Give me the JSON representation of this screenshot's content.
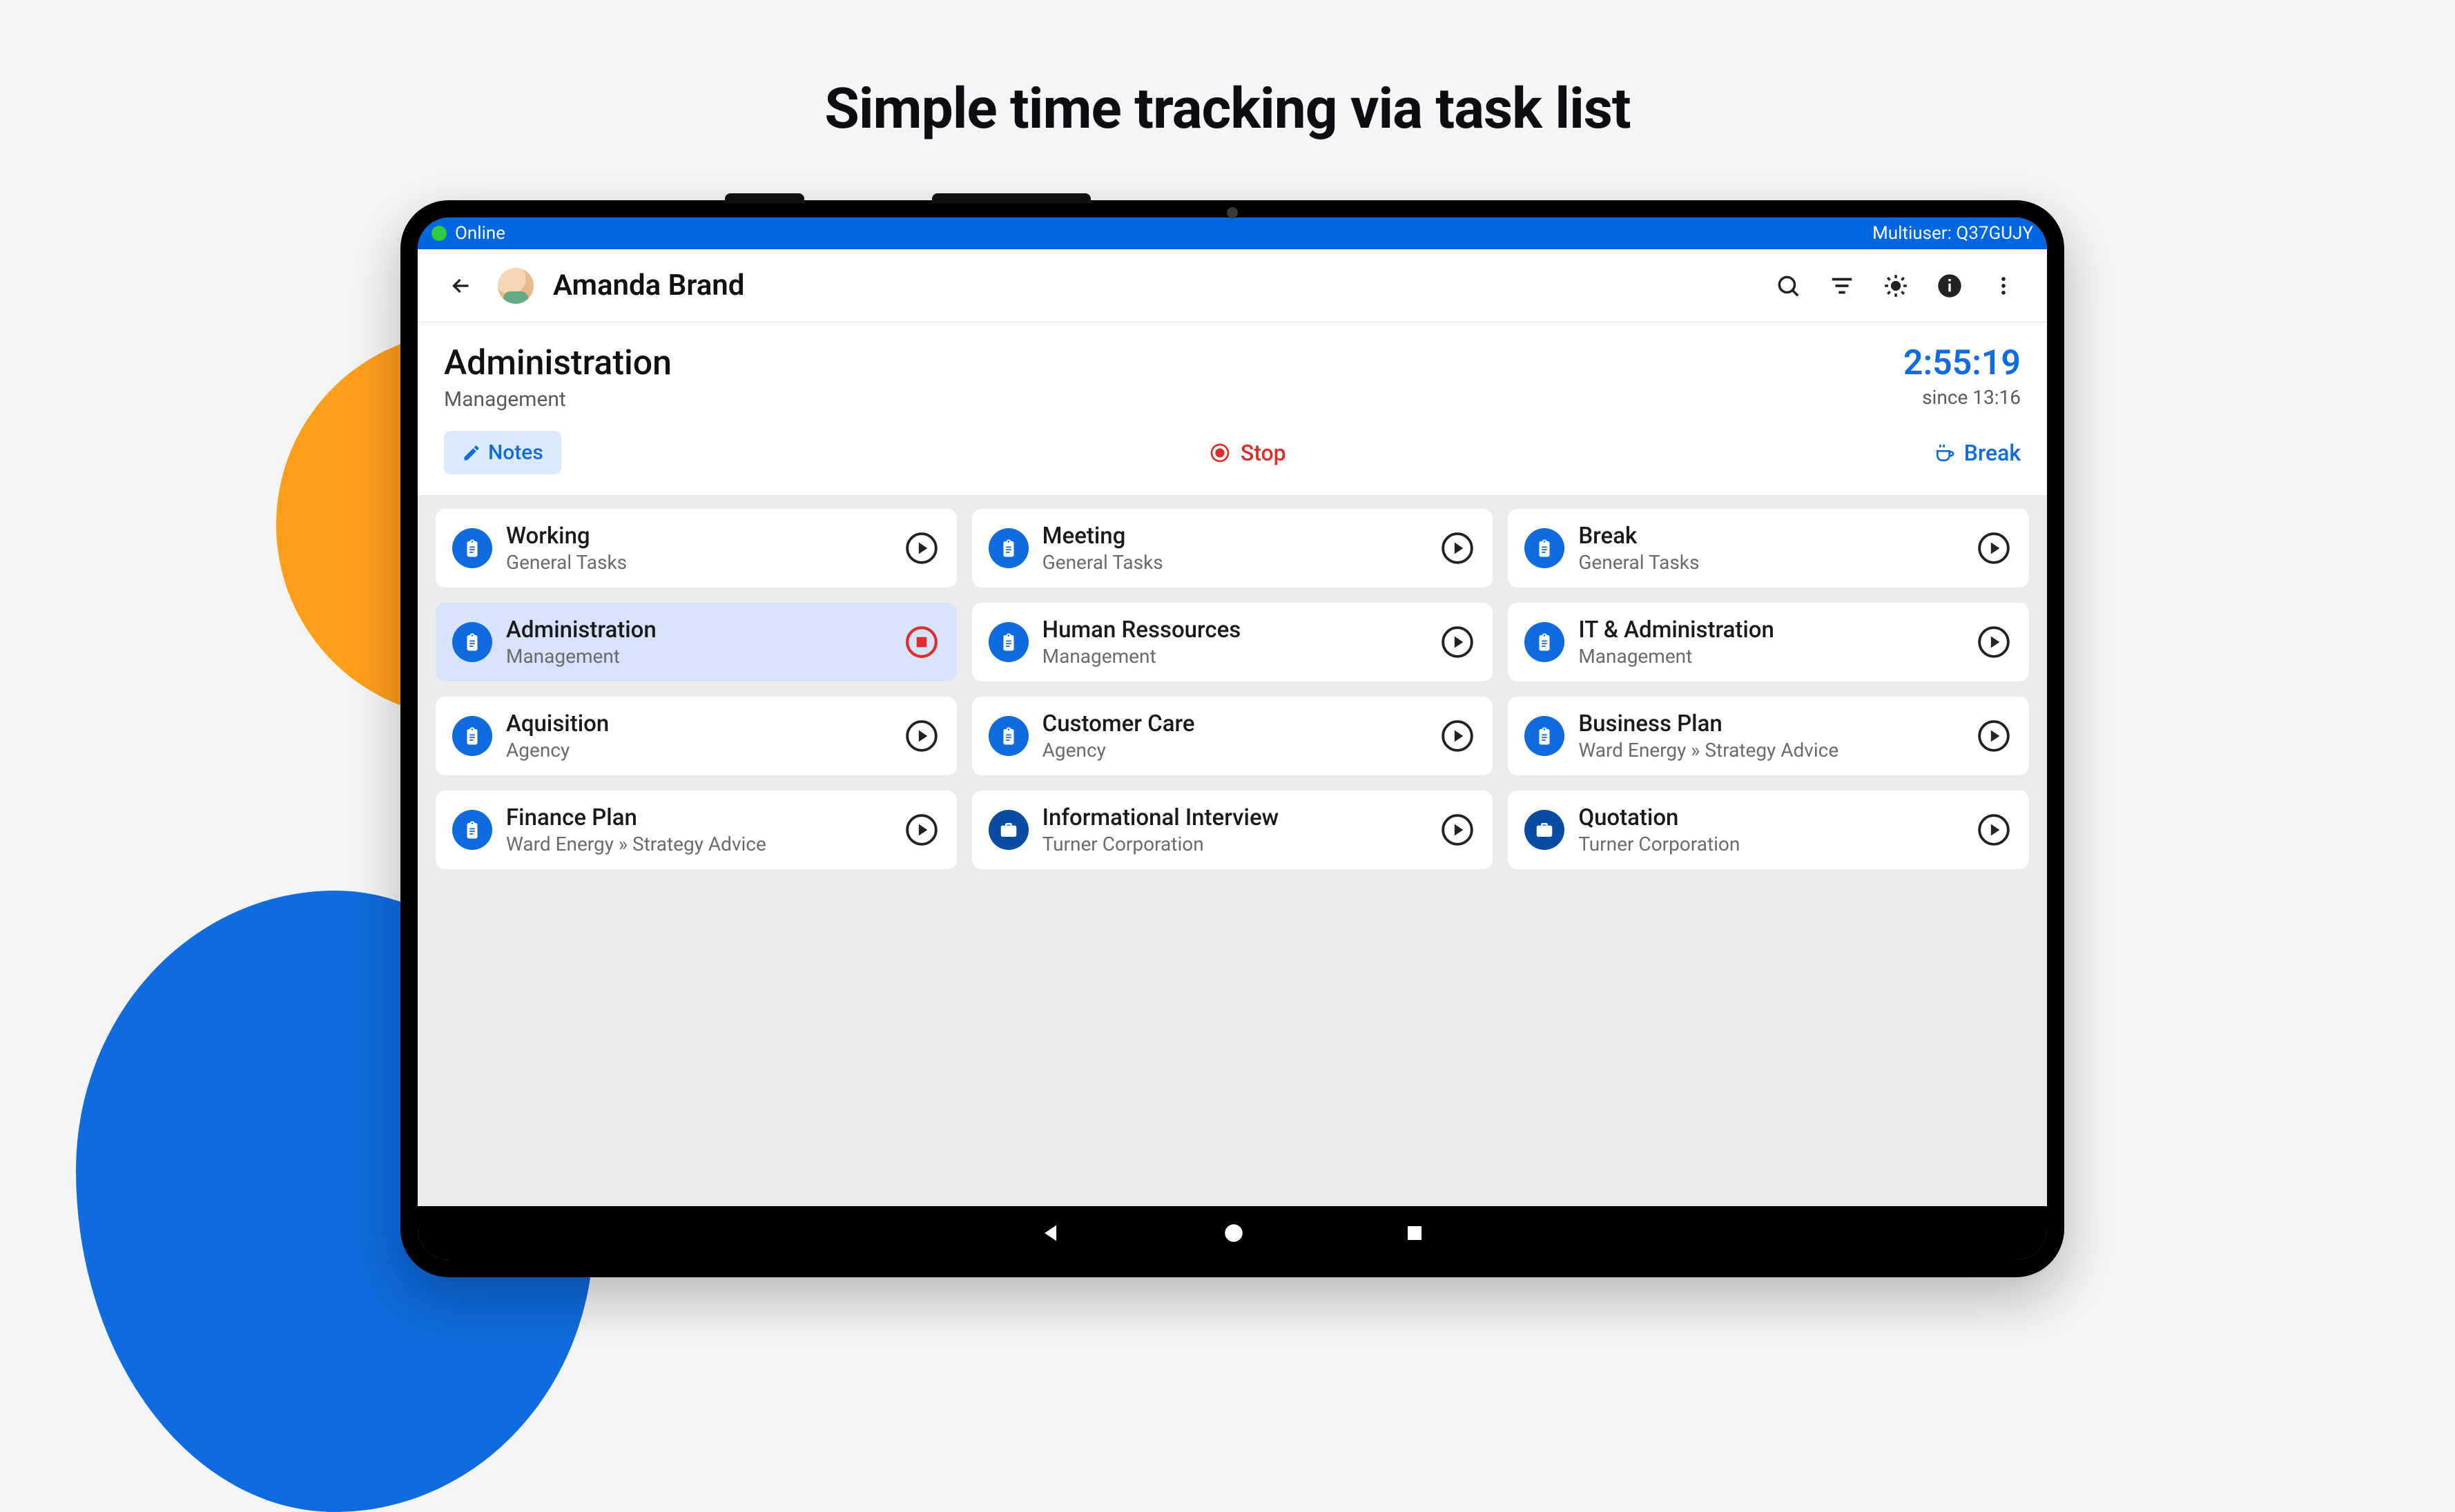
{
  "page_heading": "Simple time tracking via task list",
  "status": {
    "online_label": "Online",
    "multiuser_label": "Multiuser: Q37GUJY"
  },
  "header": {
    "user_name": "Amanda Brand"
  },
  "current": {
    "title": "Administration",
    "subtitle": "Management",
    "elapsed": "2:55:19",
    "since": "since 13:16"
  },
  "actions": {
    "notes": "Notes",
    "stop": "Stop",
    "break": "Break"
  },
  "tasks": [
    {
      "name": "Working",
      "sub": "General Tasks",
      "icon": "clipboard",
      "state": "idle"
    },
    {
      "name": "Meeting",
      "sub": "General Tasks",
      "icon": "clipboard",
      "state": "idle"
    },
    {
      "name": "Break",
      "sub": "General Tasks",
      "icon": "clipboard",
      "state": "idle"
    },
    {
      "name": "Administration",
      "sub": "Management",
      "icon": "clipboard",
      "state": "active"
    },
    {
      "name": "Human Ressources",
      "sub": "Management",
      "icon": "clipboard",
      "state": "idle"
    },
    {
      "name": "IT & Administration",
      "sub": "Management",
      "icon": "clipboard",
      "state": "idle"
    },
    {
      "name": "Aquisition",
      "sub": "Agency",
      "icon": "clipboard",
      "state": "idle"
    },
    {
      "name": "Customer Care",
      "sub": "Agency",
      "icon": "clipboard",
      "state": "idle"
    },
    {
      "name": "Business Plan",
      "sub": "Ward Energy  »  Strategy Advice",
      "icon": "clipboard",
      "state": "idle"
    },
    {
      "name": "Finance Plan",
      "sub": "Ward Energy  »  Strategy Advice",
      "icon": "clipboard",
      "state": "idle"
    },
    {
      "name": "Informational Interview",
      "sub": "Turner Corporation",
      "icon": "briefcase",
      "state": "idle"
    },
    {
      "name": "Quotation",
      "sub": "Turner Corporation",
      "icon": "briefcase",
      "state": "idle"
    }
  ]
}
